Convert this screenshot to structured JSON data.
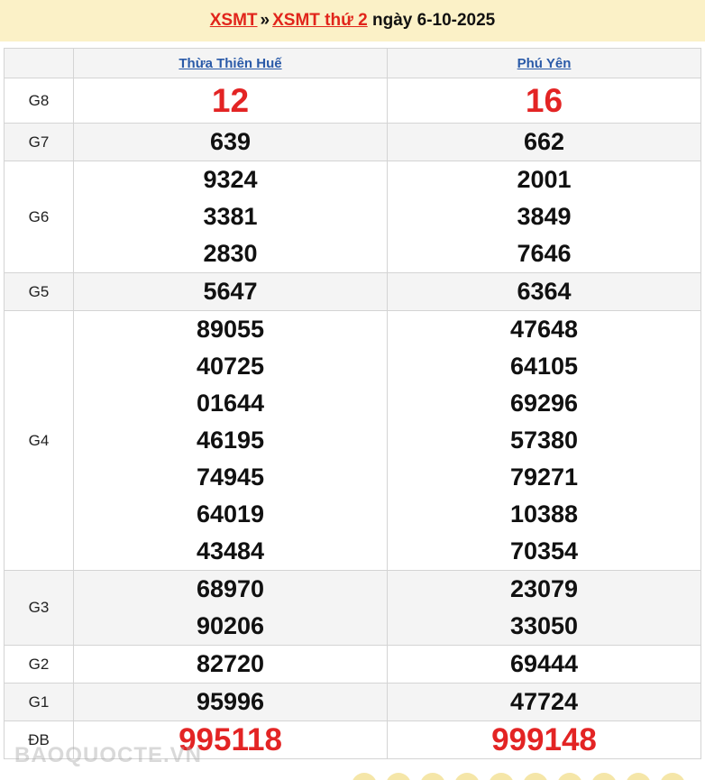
{
  "header": {
    "link1": "XSMT",
    "separator": "»",
    "link2": "XSMT thứ 2",
    "suffix": "ngày 6-10-2025"
  },
  "provinces": [
    "Thừa Thiên Huế",
    "Phú Yên"
  ],
  "rows": [
    {
      "label": "G8",
      "p1": [
        "12"
      ],
      "p2": [
        "16"
      ]
    },
    {
      "label": "G7",
      "p1": [
        "639"
      ],
      "p2": [
        "662"
      ]
    },
    {
      "label": "G6",
      "p1": [
        "9324",
        "3381",
        "2830"
      ],
      "p2": [
        "2001",
        "3849",
        "7646"
      ]
    },
    {
      "label": "G5",
      "p1": [
        "5647"
      ],
      "p2": [
        "6364"
      ]
    },
    {
      "label": "G4",
      "p1": [
        "89055",
        "40725",
        "01644",
        "46195",
        "74945",
        "64019",
        "43484"
      ],
      "p2": [
        "47648",
        "64105",
        "69296",
        "57380",
        "79271",
        "10388",
        "70354"
      ]
    },
    {
      "label": "G3",
      "p1": [
        "68970",
        "90206"
      ],
      "p2": [
        "23079",
        "33050"
      ]
    },
    {
      "label": "G2",
      "p1": [
        "82720"
      ],
      "p2": [
        "69444"
      ]
    },
    {
      "label": "G1",
      "p1": [
        "95996"
      ],
      "p2": [
        "47724"
      ]
    },
    {
      "label": "ĐB",
      "p1": [
        "995118"
      ],
      "p2": [
        "999148"
      ]
    }
  ],
  "watermark": "BAOQUOCTE.VN",
  "colors": {
    "header_bg": "#fbf1c7",
    "link_red": "#e1251b",
    "province_link": "#2a5aa8",
    "prize_red": "#e32424",
    "row_shade": "#f4f4f4"
  }
}
